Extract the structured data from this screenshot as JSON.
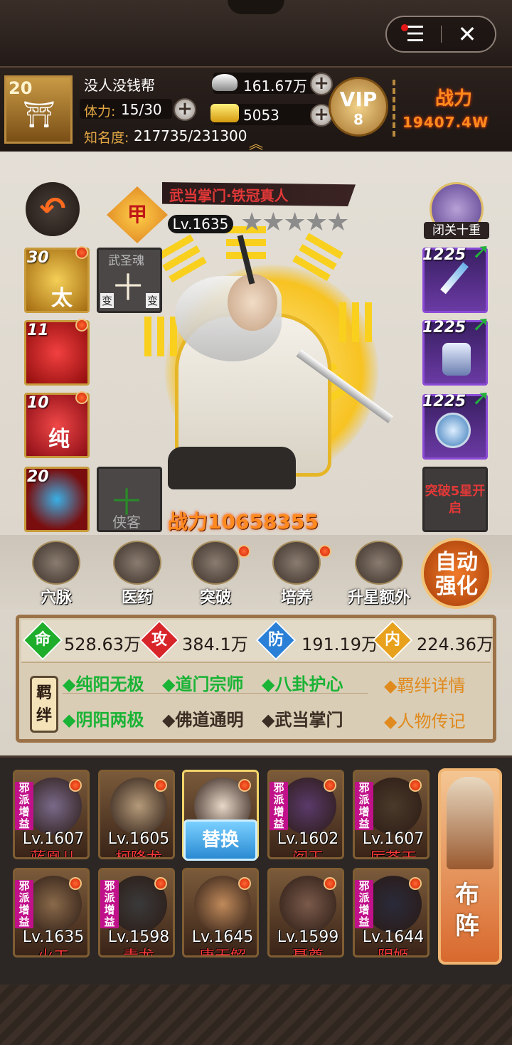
{
  "system": {
    "menu_icon": "menu-icon",
    "close_symbol": "✕"
  },
  "player": {
    "level": "20",
    "guild_name": "没人没钱帮",
    "stamina_label": "体力:",
    "stamina_value": "15/30",
    "fame_label": "知名度:",
    "fame_value": "217735/231300",
    "silver": "161.67万",
    "gold": "5053",
    "vip_label": "VIP",
    "vip_level": "8",
    "power_label": "战力",
    "power_value": "19407.4W"
  },
  "hero": {
    "title": "武当掌门·铁冠真人",
    "rank_badge": "甲",
    "level": "Lv.1635",
    "stars": "★★★★★",
    "power": "战力10658355",
    "seclusion_label": "闭关十重"
  },
  "skills": [
    {
      "level": "30",
      "glyph": "太"
    },
    {
      "level": "11",
      "glyph": ""
    },
    {
      "level": "10",
      "glyph": "纯"
    },
    {
      "level": "20",
      "glyph": ""
    }
  ],
  "slots": {
    "martial_soul": {
      "title": "武圣魂",
      "glyph": "十",
      "left": "变",
      "right": "变"
    },
    "companion": {
      "glyph": "十",
      "label": "侠客"
    },
    "breakthrough": "突破5星开启"
  },
  "equipment": [
    {
      "level": "1225"
    },
    {
      "level": "1225"
    },
    {
      "level": "1225"
    }
  ],
  "functions": [
    {
      "label": "穴脉",
      "dot": false
    },
    {
      "label": "医药",
      "dot": false
    },
    {
      "label": "突破",
      "dot": true
    },
    {
      "label": "培养",
      "dot": true
    },
    {
      "label": "升星额外",
      "dot": false
    }
  ],
  "auto_enhance": {
    "line1": "自动",
    "line2": "强化"
  },
  "stats": [
    {
      "icon": "命",
      "value": "528.63万",
      "color": "#1fae2c"
    },
    {
      "icon": "攻",
      "value": "384.1万",
      "color": "#d8252a"
    },
    {
      "icon": "防",
      "value": "191.19万",
      "color": "#2a7fd6"
    },
    {
      "icon": "内",
      "value": "224.36万",
      "color": "#e8a11c"
    }
  ],
  "fetters": {
    "label": "羁绊",
    "row1": [
      "◆纯阳无极",
      "◆道门宗师",
      "◆八卦护心"
    ],
    "row2_active": "◆阴阳两极",
    "row2_inactive": [
      "◆佛道通明",
      "◆武当掌门"
    ],
    "link1": "◆羁绊详情",
    "link2": "◆人物传记"
  },
  "roster": [
    {
      "level": "Lv.1607",
      "name": "蓝凰儿",
      "tag": "邪派增益"
    },
    {
      "level": "Lv.1605",
      "name": "柯降龙",
      "tag": ""
    },
    {
      "level": "",
      "name": "",
      "tag": ""
    },
    {
      "level": "Lv.1602",
      "name": "阎王",
      "tag": "邪派增益"
    },
    {
      "level": "Lv.1607",
      "name": "厉苍天",
      "tag": "邪派增益"
    },
    {
      "level": "Lv.1635",
      "name": "火工",
      "tag": "邪派增益"
    },
    {
      "level": "Lv.1598",
      "name": "青龙",
      "tag": "邪派增益"
    },
    {
      "level": "Lv.1645",
      "name": "唐无解",
      "tag": ""
    },
    {
      "level": "Lv.1599",
      "name": "聂尊",
      "tag": ""
    },
    {
      "level": "Lv.1644",
      "name": "阴姬",
      "tag": "邪派增益"
    }
  ],
  "swap_label": "替换",
  "formation": {
    "line1": "布",
    "line2": "阵"
  }
}
